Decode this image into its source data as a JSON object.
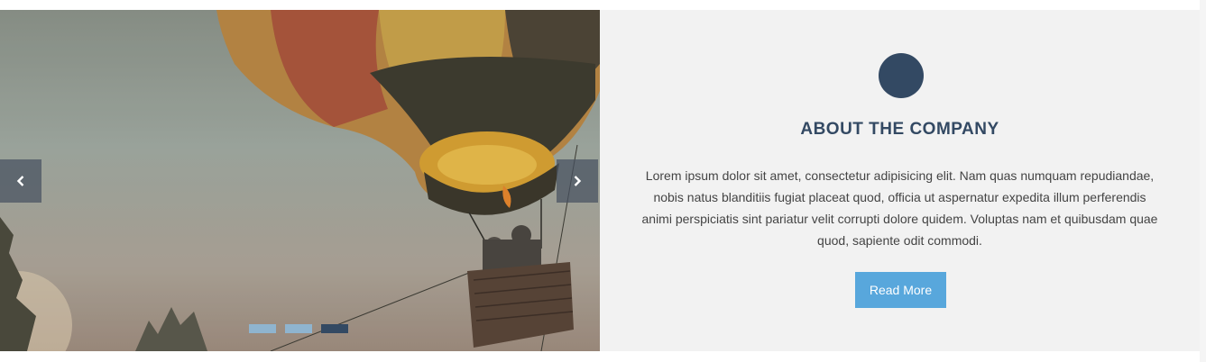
{
  "slider": {
    "prev_icon": "chevron-left-icon",
    "next_icon": "chevron-right-icon",
    "slide_count": 3,
    "active_slide": 3,
    "image": "hot-air-balloon"
  },
  "about": {
    "icon": "circle-icon",
    "title": "ABOUT THE COMPANY",
    "text": "Lorem ipsum dolor sit amet, consectetur adipisicing elit. Nam quas numquam repudiandae, nobis natus blanditiis fugiat placeat quod, officia ut aspernatur expedita illum perferendis animi perspiciatis sint pariatur velit corrupti dolore quidem. Voluptas nam et quibusdam quae quod, sapiente odit commodi.",
    "button_label": "Read More"
  },
  "colors": {
    "accent_dark": "#334963",
    "button": "#58a7dc",
    "panel_bg": "#f2f2f2",
    "dot_inactive": "#8fb4cf"
  }
}
